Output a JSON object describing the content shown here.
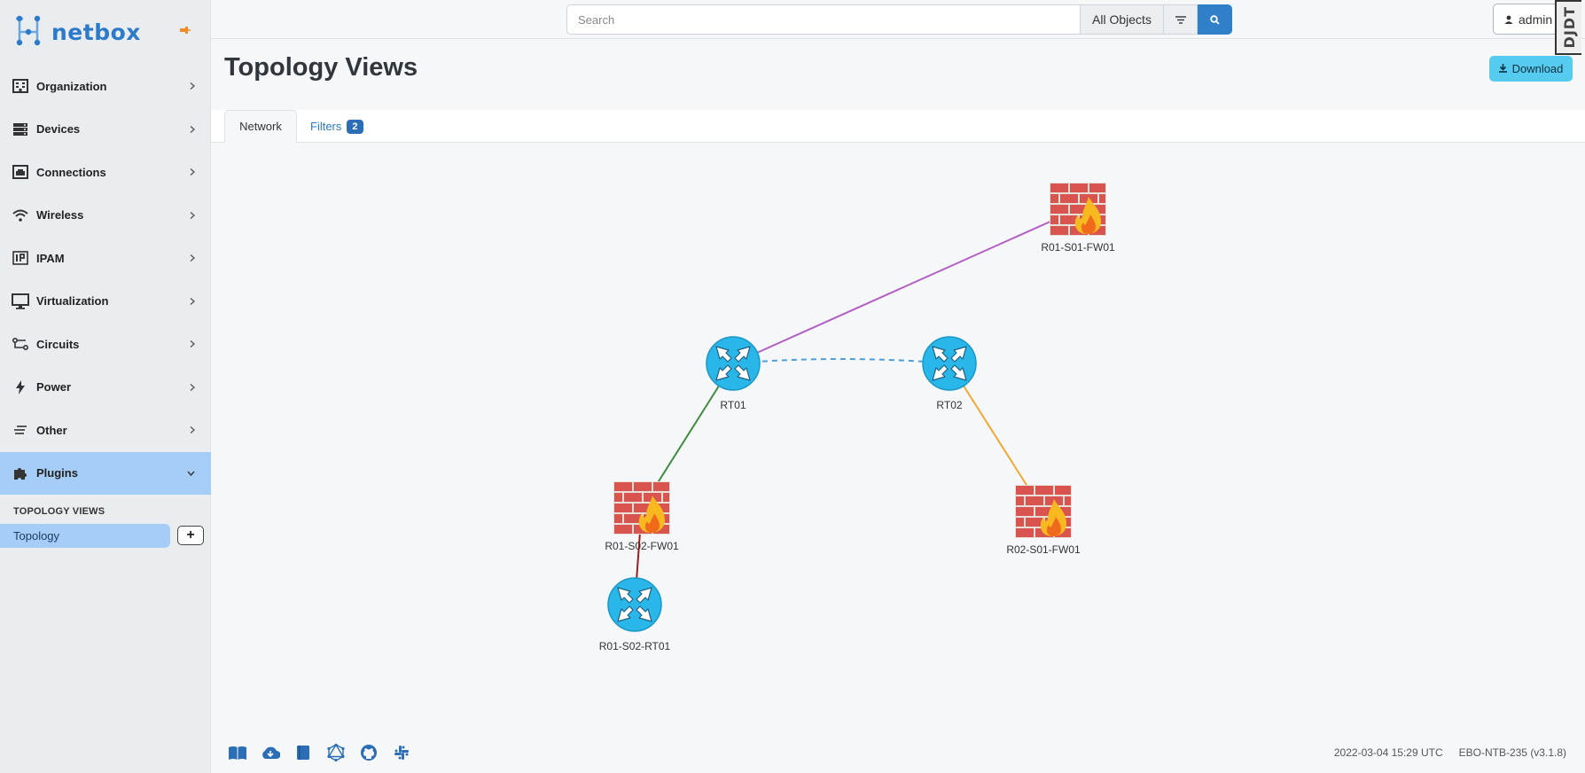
{
  "app": {
    "brand": "netbox"
  },
  "sidebar": {
    "items": [
      {
        "label": "Organization",
        "icon": "building-icon"
      },
      {
        "label": "Devices",
        "icon": "server-icon"
      },
      {
        "label": "Connections",
        "icon": "ethernet-icon"
      },
      {
        "label": "Wireless",
        "icon": "wifi-icon"
      },
      {
        "label": "IPAM",
        "icon": "ip-icon"
      },
      {
        "label": "Virtualization",
        "icon": "monitor-icon"
      },
      {
        "label": "Circuits",
        "icon": "circuit-icon"
      },
      {
        "label": "Power",
        "icon": "bolt-icon"
      },
      {
        "label": "Other",
        "icon": "lines-icon"
      },
      {
        "label": "Plugins",
        "icon": "puzzle-icon",
        "active": true
      }
    ],
    "section_title": "TOPOLOGY VIEWS",
    "sub_items": [
      {
        "label": "Topology"
      }
    ],
    "add_label": "+"
  },
  "search": {
    "placeholder": "Search",
    "scope": "All Objects"
  },
  "user": {
    "label": "admin"
  },
  "debug_toolbar": {
    "label": "DJDT"
  },
  "page": {
    "title": "Topology Views",
    "download_label": "Download"
  },
  "tabs": [
    {
      "label": "Network",
      "active": true
    },
    {
      "label": "Filters",
      "badge": "2"
    }
  ],
  "topology": {
    "nodes": [
      {
        "id": "rt01",
        "label": "RT01",
        "type": "router"
      },
      {
        "id": "rt02",
        "label": "RT02",
        "type": "router"
      },
      {
        "id": "r01s01fw01",
        "label": "R01-S01-FW01",
        "type": "firewall"
      },
      {
        "id": "r01s02fw01",
        "label": "R01-S02-FW01",
        "type": "firewall"
      },
      {
        "id": "r02s01fw01",
        "label": "R02-S01-FW01",
        "type": "firewall"
      },
      {
        "id": "r01s02rt01",
        "label": "R01-S02-RT01",
        "type": "router"
      }
    ],
    "edges": [
      {
        "from": "rt01",
        "to": "r01s01fw01",
        "color": "#b35fc4",
        "style": "solid"
      },
      {
        "from": "rt01",
        "to": "rt02",
        "color": "#4f9fd6",
        "style": "dashed"
      },
      {
        "from": "rt01",
        "to": "r01s02fw01",
        "color": "#3d8c40",
        "style": "solid"
      },
      {
        "from": "rt02",
        "to": "r02s01fw01",
        "color": "#f0a830",
        "style": "solid"
      },
      {
        "from": "r01s02fw01",
        "to": "r01s02rt01",
        "color": "#a11d1d",
        "style": "solid"
      }
    ]
  },
  "footer": {
    "icons": [
      "book-icon",
      "cloud-icon",
      "docs-icon",
      "graphql-icon",
      "github-icon",
      "slack-icon"
    ],
    "timestamp": "2022-03-04 15:29 UTC",
    "version": "EBO-NTB-235 (v3.1.8)"
  },
  "colors": {
    "accent": "#2c7ac9",
    "active_nav": "#a6cdf5",
    "download": "#55cbf0",
    "router": "#29b6e8",
    "firewall_brick": "#d9534f"
  }
}
